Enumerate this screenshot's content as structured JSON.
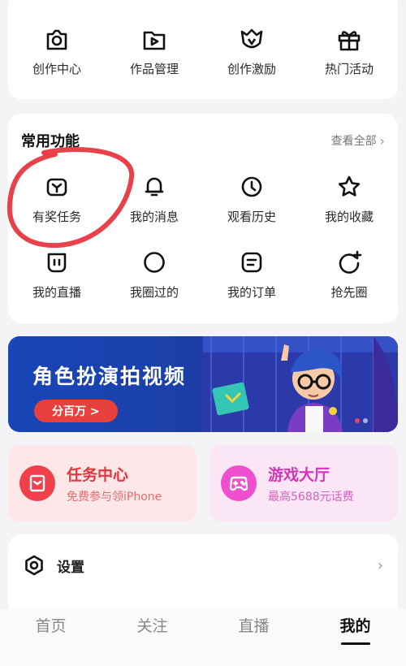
{
  "creator_row": [
    {
      "label": "创作中心",
      "icon": "camera-icon"
    },
    {
      "label": "作品管理",
      "icon": "video-folder-icon"
    },
    {
      "label": "创作激励",
      "icon": "v-badge-icon"
    },
    {
      "label": "热门活动",
      "icon": "gift-icon"
    }
  ],
  "common": {
    "title": "常用功能",
    "see_all": "查看全部",
    "items": [
      {
        "label": "有奖任务",
        "icon": "reward-task-icon"
      },
      {
        "label": "我的消息",
        "icon": "bell-icon"
      },
      {
        "label": "观看历史",
        "icon": "clock-icon"
      },
      {
        "label": "我的收藏",
        "icon": "star-icon"
      },
      {
        "label": "我的直播",
        "icon": "live-icon"
      },
      {
        "label": "我圈过的",
        "icon": "circle-icon"
      },
      {
        "label": "我的订单",
        "icon": "order-icon"
      },
      {
        "label": "抢先圈",
        "icon": "circle-plus-icon"
      }
    ]
  },
  "banner": {
    "title": "角色扮演拍视频",
    "button": "分百万 >"
  },
  "promos": [
    {
      "title": "任务中心",
      "subtitle": "免费参与领iPhone",
      "icon": "task-center-icon"
    },
    {
      "title": "游戏大厅",
      "subtitle": "最高5688元话费",
      "icon": "gamepad-icon"
    }
  ],
  "settings": {
    "label": "设置",
    "icon": "settings-hex-icon"
  },
  "bottom_nav": [
    {
      "label": "首页",
      "active": false
    },
    {
      "label": "关注",
      "active": false
    },
    {
      "label": "直播",
      "active": false
    },
    {
      "label": "我的",
      "active": true
    }
  ],
  "colors": {
    "annotation_red": "#e8414a",
    "task_red": "#f0414a",
    "game_pink": "#ee4fcf",
    "banner_blue": "#1846b8"
  }
}
